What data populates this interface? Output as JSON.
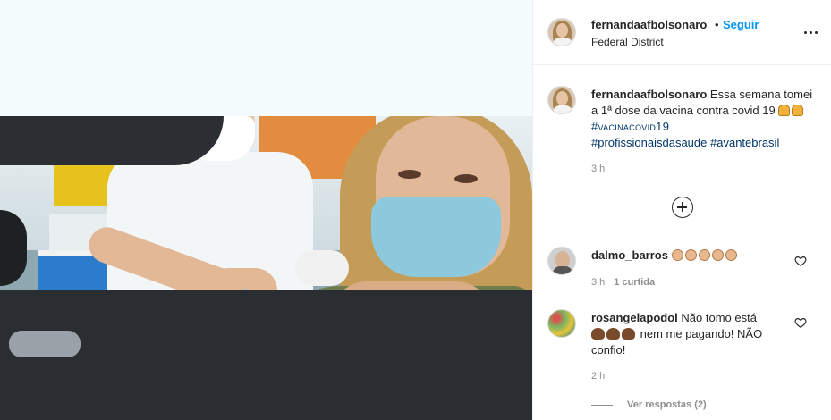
{
  "post": {
    "username": "fernandaafbolsonaro",
    "follow_separator": "•",
    "follow_label": "Seguir",
    "location": "Federal District",
    "more_icon": "more-horizontal-icon"
  },
  "caption": {
    "username": "fernandaafbolsonaro",
    "text": "Essa semana tomei a 1ª dose da vacina contra covid 19",
    "emojis": [
      "person-raising-hands",
      "person-raising-hands"
    ],
    "hashtags": [
      "#vacinacovid19",
      "#profissionaisdasaude",
      "#avantebrasil"
    ],
    "time": "3 h"
  },
  "load_more_icon": "plus-circle-icon",
  "comments": [
    {
      "username": "dalmo_barros",
      "emoji_count": 5,
      "emoji_name": "clapping-hands",
      "time": "3 h",
      "likes": "1 curtida"
    },
    {
      "username": "rosangelapodol",
      "text_part1": "Não tomo está",
      "text_part2": "nem me pagando! NÃO confio!",
      "emoji_name": "pile-of-poo",
      "emoji_count": 3,
      "time": "2 h"
    }
  ],
  "view_replies": "Ver respostas (2)"
}
